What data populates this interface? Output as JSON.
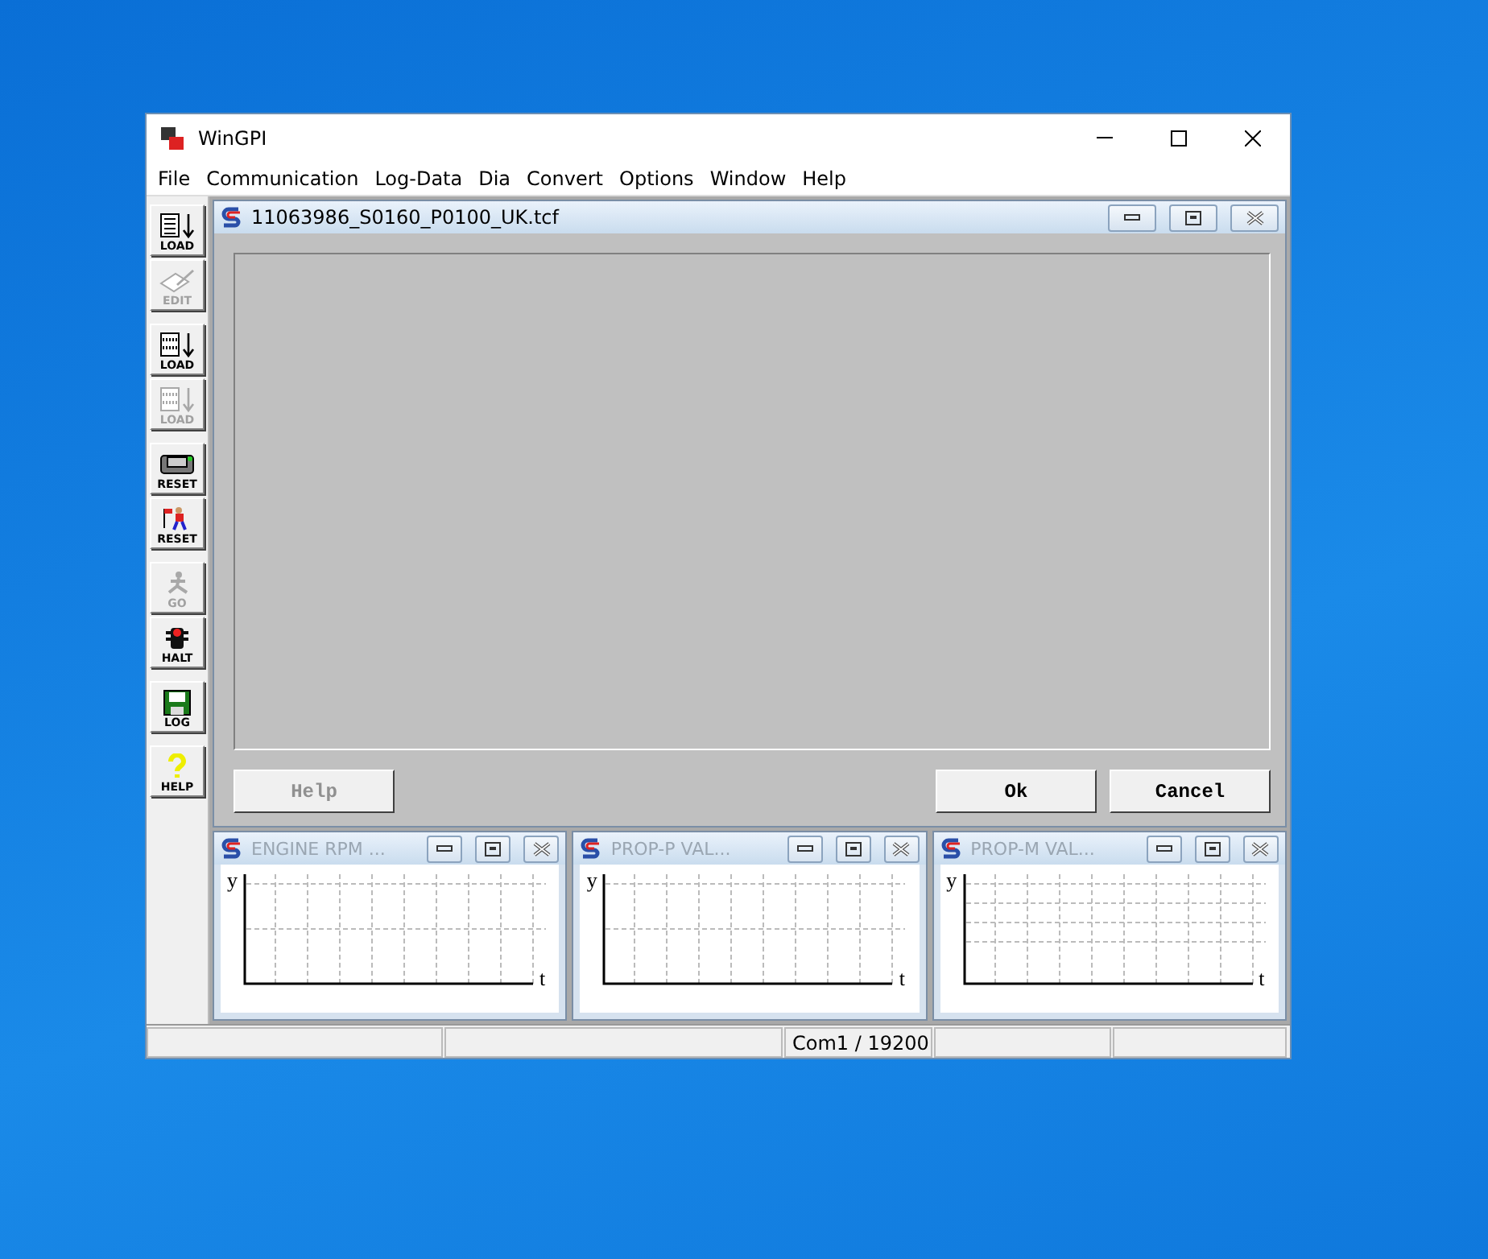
{
  "window": {
    "title": "WinGPI"
  },
  "menu": [
    "File",
    "Communication",
    "Log-Data",
    "Dia",
    "Convert",
    "Options",
    "Window",
    "Help"
  ],
  "toolbar": [
    [
      {
        "kind": "load",
        "label": "LOAD",
        "disabled": false
      },
      {
        "kind": "edit",
        "label": "EDIT",
        "disabled": true
      }
    ],
    [
      {
        "kind": "app",
        "label": "LOAD",
        "disabled": false
      },
      {
        "kind": "ker",
        "label": "LOAD",
        "disabled": true
      }
    ],
    [
      {
        "kind": "device",
        "label": "RESET",
        "disabled": false
      },
      {
        "kind": "person",
        "label": "RESET",
        "disabled": false
      }
    ],
    [
      {
        "kind": "go",
        "label": "GO",
        "disabled": true
      },
      {
        "kind": "halt",
        "label": "HALT",
        "disabled": false
      }
    ],
    [
      {
        "kind": "log",
        "label": "LOG",
        "disabled": false
      }
    ],
    [
      {
        "kind": "help",
        "label": "HELP",
        "disabled": false
      }
    ]
  ],
  "dialog": {
    "title": "11063986_S0160_P0100_UK.tcf",
    "buttons": [
      {
        "label": "Help",
        "disabled": true
      },
      {
        "label": "Ok",
        "disabled": false
      },
      {
        "label": "Cancel",
        "disabled": false
      }
    ]
  },
  "graphs": [
    {
      "title": "ENGINE RPM ...",
      "y_label": "y",
      "x_label": "t"
    },
    {
      "title": "PROP-P VAL...",
      "y_label": "y",
      "x_label": "t"
    },
    {
      "title": "PROP-M VAL...",
      "y_label": "y",
      "x_label": "t"
    }
  ],
  "status_bar": {
    "cell_3": "Com1 / 19200"
  }
}
